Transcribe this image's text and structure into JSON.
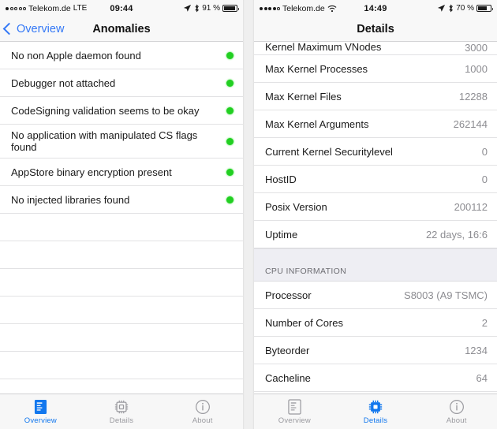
{
  "accent_blue": "#1177ee",
  "led_green": "#22cf22",
  "inactive_gray": "#9a9a9f",
  "left_phone": {
    "status_bar": {
      "signal_dots": "1 filled of 5",
      "carrier": "Telekom.de",
      "network": "LTE",
      "time": "09:44",
      "location_icon": "location-arrow-icon",
      "bluetooth_icon": "bluetooth-icon",
      "battery_percent": "91 %",
      "battery_level": 91
    },
    "nav_bar": {
      "back_label": "Overview",
      "title": "Anomalies"
    },
    "anomalies": [
      {
        "label": "No non Apple daemon found",
        "status": "ok"
      },
      {
        "label": "Debugger not attached",
        "status": "ok"
      },
      {
        "label": "CodeSigning validation seems to be okay",
        "status": "ok"
      },
      {
        "label": "No application with manipulated CS flags found",
        "status": "ok"
      },
      {
        "label": "AppStore binary encryption present",
        "status": "ok"
      },
      {
        "label": "No injected libraries found",
        "status": "ok"
      }
    ],
    "empty_rows": 7,
    "tab_bar": {
      "tabs": [
        {
          "label": "Overview",
          "icon": "document-list-icon",
          "active": true
        },
        {
          "label": "Details",
          "icon": "cpu-chip-icon",
          "active": false
        },
        {
          "label": "About",
          "icon": "info-circle-icon",
          "active": false
        }
      ]
    }
  },
  "right_phone": {
    "status_bar": {
      "signal_dots": "4 filled of 5",
      "carrier": "Telekom.de",
      "wifi_icon": "wifi-icon",
      "time": "14:49",
      "location_icon": "location-arrow-icon",
      "bluetooth_icon": "bluetooth-icon",
      "battery_percent": "70 %",
      "battery_level": 70
    },
    "nav_bar": {
      "title": "Details"
    },
    "rows": [
      {
        "label": "Kernel Maximum VNodes",
        "value": "3000",
        "clipped": true
      },
      {
        "label": "Max Kernel Processes",
        "value": "1000"
      },
      {
        "label": "Max Kernel Files",
        "value": "12288"
      },
      {
        "label": "Max Kernel Arguments",
        "value": "262144"
      },
      {
        "label": "Current Kernel Securitylevel",
        "value": "0"
      },
      {
        "label": "HostID",
        "value": "0"
      },
      {
        "label": "Posix Version",
        "value": "200112"
      },
      {
        "label": "Uptime",
        "value": "22 days, 16:6"
      }
    ],
    "section_header": "CPU INFORMATION",
    "cpu_rows": [
      {
        "label": "Processor",
        "value": "S8003 (A9 TSMC)"
      },
      {
        "label": "Number of Cores",
        "value": "2"
      },
      {
        "label": "Byteorder",
        "value": "1234"
      },
      {
        "label": "Cacheline",
        "value": "64"
      }
    ],
    "tab_bar": {
      "tabs": [
        {
          "label": "Overview",
          "icon": "document-list-icon",
          "active": false
        },
        {
          "label": "Details",
          "icon": "cpu-chip-icon",
          "active": true
        },
        {
          "label": "About",
          "icon": "info-circle-icon",
          "active": false
        }
      ]
    }
  }
}
